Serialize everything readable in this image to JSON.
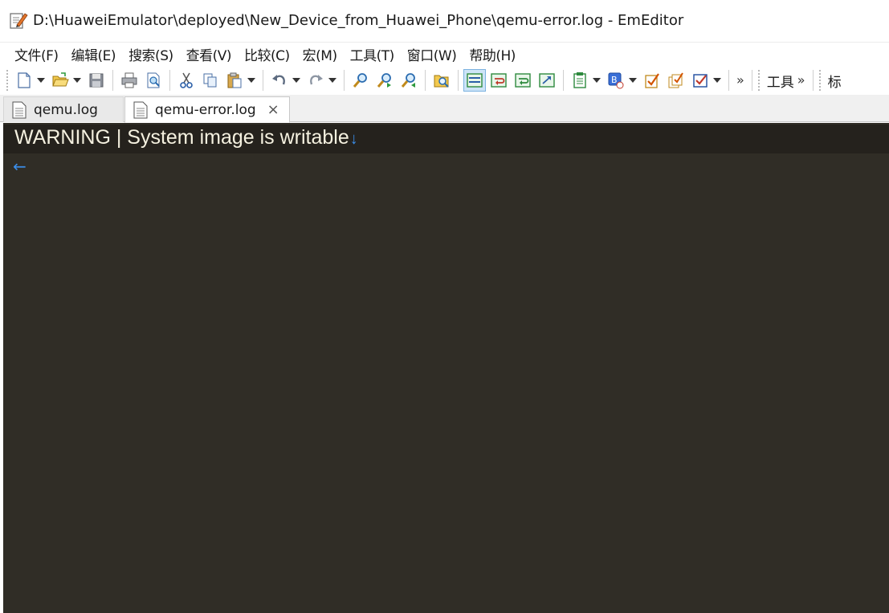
{
  "window": {
    "title": "D:\\HuaweiEmulator\\deployed\\New_Device_from_Huawei_Phone\\qemu-error.log - EmEditor"
  },
  "menu": [
    {
      "label": "文件(F)"
    },
    {
      "label": "编辑(E)"
    },
    {
      "label": "搜索(S)"
    },
    {
      "label": "查看(V)"
    },
    {
      "label": "比较(C)"
    },
    {
      "label": "宏(M)"
    },
    {
      "label": "工具(T)"
    },
    {
      "label": "窗口(W)"
    },
    {
      "label": "帮助(H)"
    }
  ],
  "toolbar": {
    "tools_label": "工具",
    "truncated_label": "标",
    "overflow_glyph": "»"
  },
  "tabs": [
    {
      "label": "qemu.log",
      "active": false
    },
    {
      "label": "qemu-error.log",
      "active": true,
      "close_glyph": "×"
    }
  ],
  "editor": {
    "lines": [
      "WARNING | System image is writable"
    ],
    "eol_glyph": "↓",
    "eof_glyph": "←",
    "background": "#302d26",
    "current_line_background": "#25221d",
    "text_color": "#f5f1e0",
    "marker_color": "#3b8de8"
  },
  "icons": [
    "new-document-icon",
    "open-folder-icon",
    "save-icon",
    "print-icon",
    "print-preview-icon",
    "cut-icon",
    "copy-icon",
    "paste-icon",
    "undo-icon",
    "redo-icon",
    "find-icon",
    "find-next-icon",
    "find-previous-icon",
    "find-in-files-icon",
    "word-wrap-icon",
    "wrap-by-window-icon",
    "wrap-by-page-icon",
    "wrap-by-column-icon",
    "clipboard-list-icon",
    "character-code-icon",
    "macro-run-icon",
    "macro-record-icon",
    "checkbox-icon"
  ]
}
